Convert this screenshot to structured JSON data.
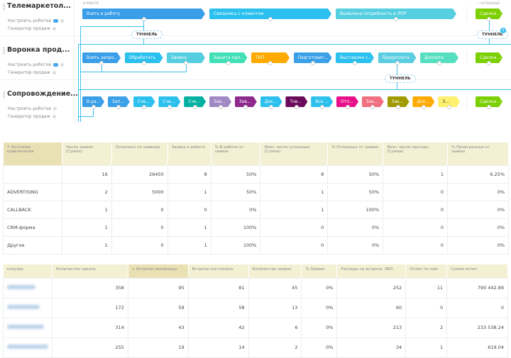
{
  "pipelines": [
    {
      "title": "Телемаркетол...",
      "robots": "Настроить роботов",
      "generator": "Генератор продаж",
      "stages": [
        {
          "label": "Взять в работу",
          "color": "#3a9ee8"
        },
        {
          "label": "Связались с клиентом",
          "color": "#2bc0ee"
        },
        {
          "label": "Выявлена потребность и ЛПР",
          "color": "#55cfe0"
        }
      ],
      "success": "Сделка ..."
    },
    {
      "title": "Воронка прод...",
      "robots": "Настроить роботов",
      "generator": "Генератор продаж",
      "stages": [
        {
          "label": "Взять запро...",
          "color": "#3a9ee8"
        },
        {
          "label": "Обработать",
          "color": "#2bc0ee"
        },
        {
          "label": "Заявка",
          "color": "#55cfe0"
        },
        {
          "label": "Защита про...",
          "color": "#40dfb6"
        },
        {
          "label": "ТКП",
          "color": "#ffaa00"
        },
        {
          "label": "Подготовит...",
          "color": "#3aa0e8"
        },
        {
          "label": "Выставлен с...",
          "color": "#2bc0ee"
        },
        {
          "label": "Предоплата",
          "color": "#5acde0"
        },
        {
          "label": "Доплата",
          "color": "#55dfc0"
        }
      ],
      "success": "Сделка ..."
    },
    {
      "title": "Сопровождение...",
      "robots": "Настроить роботов",
      "generator": "Генератор продаж",
      "stages": [
        {
          "label": "В ра...",
          "color": "#3a9ee8"
        },
        {
          "label": "Зап...",
          "color": "#3aa0e8"
        },
        {
          "label": "Сче...",
          "color": "#2bc0ee"
        },
        {
          "label": "Сче...",
          "color": "#2bc0ee"
        },
        {
          "label": "Сче...",
          "color": "#00b0a0"
        },
        {
          "label": "Зав...",
          "color": "#a088c4"
        },
        {
          "label": "Зав...",
          "color": "#8e2a8e"
        },
        {
          "label": "Док...",
          "color": "#2bc0ee"
        },
        {
          "label": "Тов...",
          "color": "#6a0a5a"
        },
        {
          "label": "Все ...",
          "color": "#2bc0ee"
        },
        {
          "label": "Отл...",
          "color": "#e8108a"
        },
        {
          "label": "Зак...",
          "color": "#f07080"
        },
        {
          "label": "Зак...",
          "color": "#a09a00"
        },
        {
          "label": "Доп...",
          "color": "#ffaa00"
        },
        {
          "label": "З...",
          "color": "#fff070"
        }
      ],
      "success": "Сделка ..."
    }
  ],
  "column_labels": {
    "in_work": "В РАБОТЕ",
    "success": "✓ УСПЕШНЫЕ"
  },
  "tunnel_label": "ТУННЕЛЬ",
  "tunnel_badge": "3",
  "success_color": "#7ccf00",
  "table1": {
    "headers": [
      "↑ Источник привлечения",
      "Число заявок (Сумма)",
      "Оплачено по заявкам",
      "Заявок в работе",
      "% В работе от заявок",
      "Фикс число успешных (Сумма)",
      "% Успешных от заявок",
      "Фикс число програн (Сумма)",
      "% Проигранных от заявок"
    ],
    "rows": [
      [
        "",
        "16",
        "26450",
        "8",
        "50%",
        "8",
        "50%",
        "1",
        "6.25%"
      ],
      [
        "ADVERTISING",
        "2",
        "5000",
        "1",
        "50%",
        "1",
        "50%",
        "0",
        "0%"
      ],
      [
        "CALLBACK",
        "1",
        "0",
        "0",
        "0%",
        "1",
        "100%",
        "0",
        "0%"
      ],
      [
        "CRM-форма",
        "1",
        "0",
        "1",
        "100%",
        "0",
        "0%",
        "0",
        "0%"
      ],
      [
        "Другое",
        "1",
        "0",
        "1",
        "100%",
        "0",
        "0%",
        "0",
        "0%"
      ]
    ]
  },
  "table2": {
    "headers": [
      "клоузер",
      "Количество сделок",
      "↓ Встречи назначены",
      "Встречи состоялись",
      "Количество заявок",
      "% Заявок",
      "Расходы на встречи, AED",
      "Оплат по ним",
      "Сумма оплат"
    ],
    "rows": [
      [
        "358",
        "95",
        "81",
        "45",
        "0%",
        "252",
        "11",
        "790 442.89"
      ],
      [
        "172",
        "59",
        "58",
        "13",
        "0%",
        "60",
        "0",
        "0"
      ],
      [
        "314",
        "43",
        "42",
        "6",
        "0%",
        "213",
        "2",
        "233 538.24"
      ],
      [
        "255",
        "19",
        "14",
        "2",
        "0%",
        "34",
        "1",
        "619.04"
      ]
    ]
  }
}
